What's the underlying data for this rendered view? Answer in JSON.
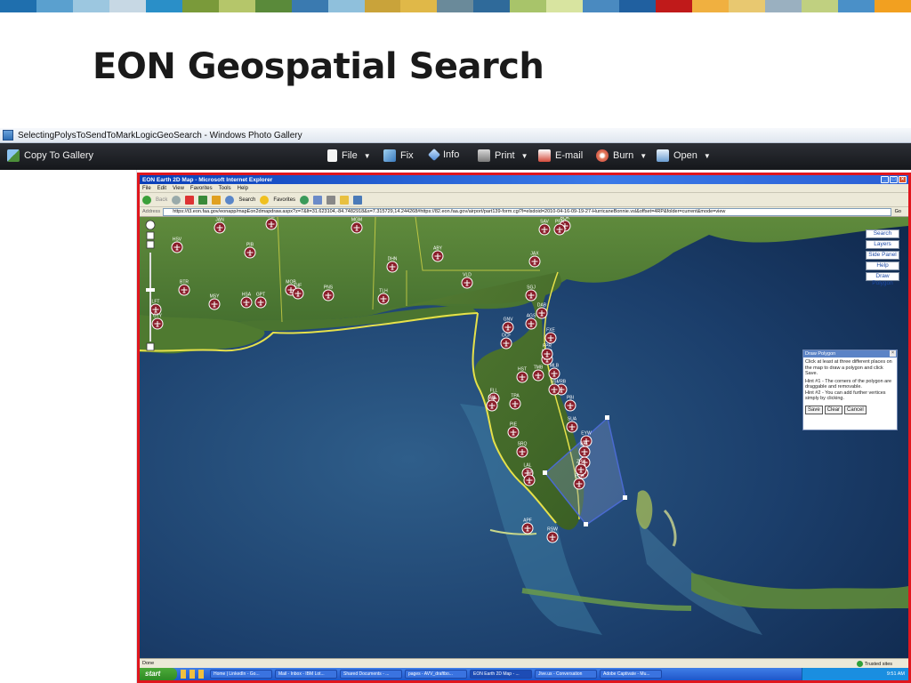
{
  "slide": {
    "title": "EON Geospatial Search",
    "stripe_colors": [
      "#1f6fae",
      "#5aa0cf",
      "#9cc7e0",
      "#c7d8e4",
      "#2a8fc8",
      "#7a9a3a",
      "#b5c66a",
      "#5a8a3a",
      "#3a7ab0",
      "#8fc0dc",
      "#c9a33a",
      "#e0b848",
      "#6a8a9a",
      "#2f6a9a",
      "#a8c46a",
      "#d8e4a0",
      "#4a8ac0",
      "#2060a0",
      "#c01a1a",
      "#f0b040",
      "#e8c870",
      "#9ab0c0",
      "#c0d080",
      "#4a90c8",
      "#f2a020"
    ]
  },
  "gallery": {
    "window_title": "SelectingPolysToSendToMarkLogicGeoSearch - Windows Photo Gallery",
    "toolbar": {
      "copy_to_gallery": "Copy To Gallery",
      "file": "File",
      "fix": "Fix",
      "info": "Info",
      "print": "Print",
      "email": "E-mail",
      "burn": "Burn",
      "open": "Open"
    }
  },
  "ie": {
    "window_title": "EON Earth 2D Map - Microsoft Internet Explorer",
    "menu": [
      "File",
      "Edit",
      "View",
      "Favorites",
      "Tools",
      "Help"
    ],
    "toolbar": {
      "back": "Back",
      "search": "Search",
      "favorites": "Favorites"
    },
    "address_label": "Address",
    "address_url": "https://t3.eon.faa.gov/eonapp/mapEon2dmapdraw.aspx?z=7&lt=31.623104,-84.7482918&s=7.315729,14.244268#https://82.eon.faa.gov/airport/part139-form.cgi?l=elsdoid=2010-04-16-09-19-27-HurricaneBonnie.vsl&offset=4RP&folder=current&mode=view",
    "go_label": "Go",
    "status": "Done",
    "zone": "Trusted sites"
  },
  "map": {
    "buttons": [
      "Search",
      "Layers",
      "Side Panel",
      "Help",
      "Draw Polygon"
    ],
    "draw_panel": {
      "title": "Draw Polygon",
      "instructions": "Click at least at three different places on the map to draw a polygon and click Save.",
      "hint1": "Hint #1 - The corners of the polygon are draggable and removable.",
      "hint2": "Hint #2 - You can add further vertices simply by clicking.",
      "save": "Save",
      "clear": "Clear",
      "cancel": "Cancel"
    },
    "airports": [
      "JAN",
      "MEI",
      "MGM",
      "HSV",
      "PIB",
      "BTR",
      "MSY",
      "LFT",
      "MOB",
      "GPT",
      "HSA",
      "PNS",
      "TLH",
      "DHN",
      "ABY",
      "VLD",
      "SAV",
      "BQK",
      "JAX",
      "SGJ",
      "DAB",
      "GNV",
      "OCF",
      "MCO",
      "MLB",
      "VRB",
      "PBI",
      "FLL",
      "MIA",
      "TPA",
      "PIE",
      "SRQ",
      "LAL",
      "RSW",
      "APF",
      "EYW",
      "MTH",
      "ECP",
      "PFN",
      "CTY",
      "GIF",
      "FPR",
      "SUA",
      "BCT",
      "TMB",
      "HST",
      "FXE",
      "AGS",
      "SSI",
      "BKL",
      "ZPH",
      "TIX"
    ]
  },
  "taskbar": {
    "start": "start",
    "tasks": [
      "Home | LinkedIn - Go...",
      "Mail - Inbox - IBM Lot...",
      "Shared Documents - ...",
      "pages - AVV_draftbo...",
      "EON Earth 2D Map - ...",
      "Jive.us - Conversation",
      "Adobe Captivate - Mu..."
    ],
    "clock": "9:51 AM"
  }
}
